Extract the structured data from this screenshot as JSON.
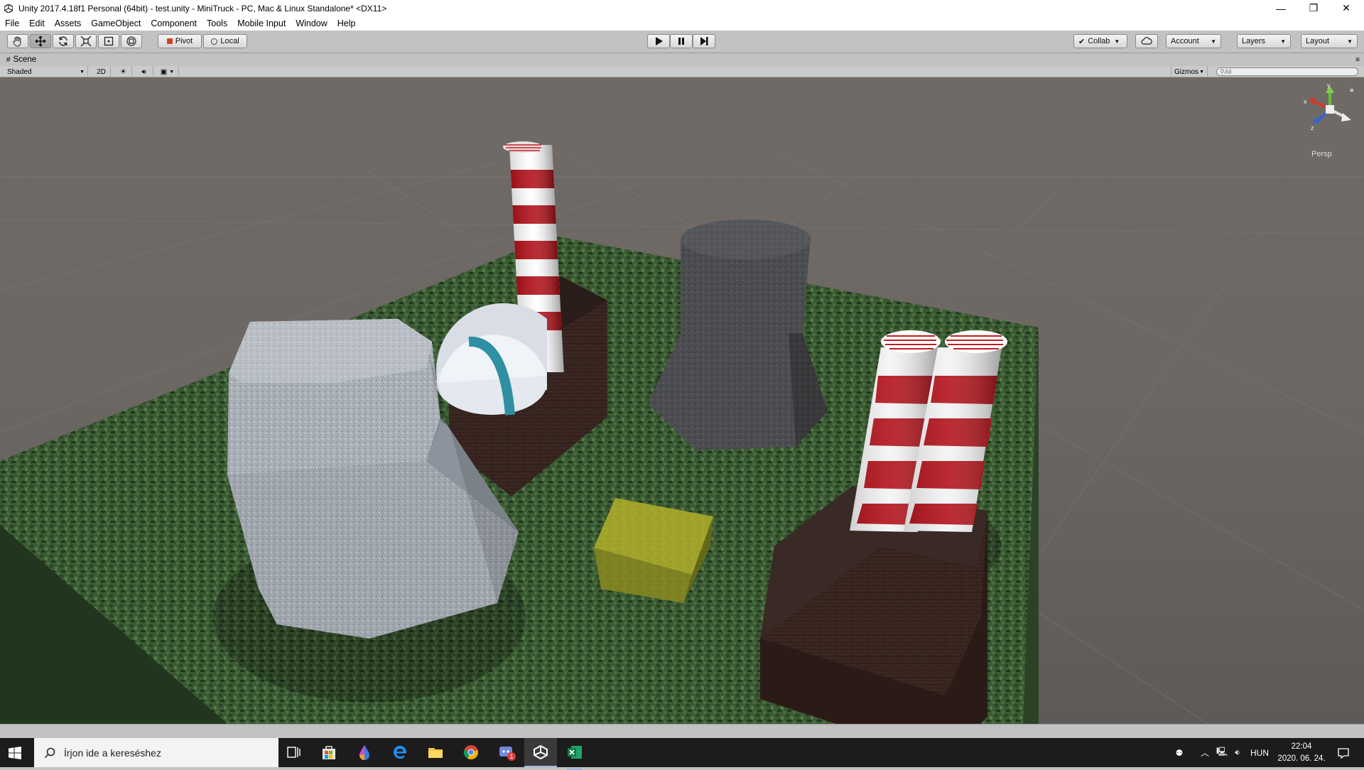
{
  "window": {
    "title": "Unity 2017.4.18f1 Personal (64bit) - test.unity - MiniTruck - PC, Mac & Linux Standalone* <DX11>",
    "minimize": "—",
    "restore": "❐",
    "close": "✕"
  },
  "menu": [
    "File",
    "Edit",
    "Assets",
    "GameObject",
    "Component",
    "Tools",
    "Mobile Input",
    "Window",
    "Help"
  ],
  "toolbar": {
    "pivot_label": "Pivot",
    "local_label": "Local",
    "collab_label": "Collab",
    "account_label": "Account",
    "layers_label": "Layers",
    "layout_label": "Layout"
  },
  "scene": {
    "tab_label": "Scene",
    "shading_mode": "Shaded",
    "mode_2d": "2D",
    "gizmos_label": "Gizmos",
    "search_placeholder": "All",
    "persp_label": "Persp",
    "axis_x": "x",
    "axis_y": "y",
    "axis_z": "z"
  },
  "taskbar": {
    "search_placeholder": "Írjon ide a kereséshez",
    "language": "HUN",
    "time": "22:04",
    "date": "2020. 06. 24.",
    "chat_badge": "1"
  },
  "colors": {
    "chrome": "#c2c2c2",
    "viewport": "#6d6864",
    "grass": "#3e5e36",
    "stripe_red": "#b3121b",
    "taskbar": "#1c1c1c"
  }
}
